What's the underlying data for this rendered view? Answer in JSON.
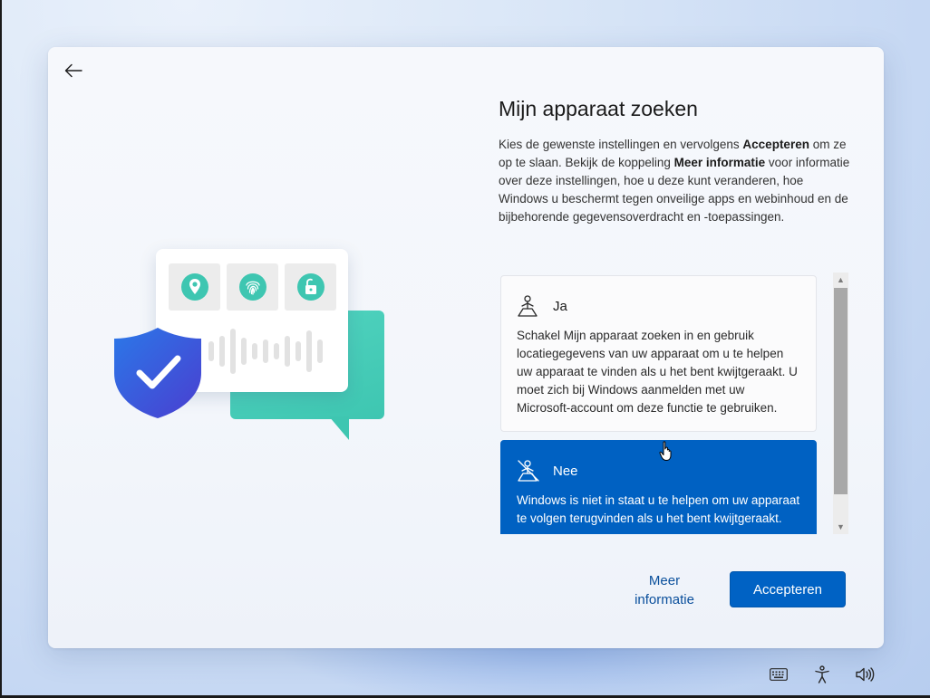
{
  "dialog": {
    "title": "Mijn apparaat zoeken",
    "description_parts": {
      "p1": "Kies de gewenste instellingen en vervolgens ",
      "b1": "Accepteren",
      "p2": " om ze op te slaan. Bekijk de koppeling ",
      "b2": "Meer informatie",
      "p3": " voor informatie over deze instellingen, hoe u deze kunt veranderen, hoe Windows u beschermt tegen onveilige apps en webinhoud en de bijbehorende gegevensoverdracht en -toepassingen."
    },
    "options": [
      {
        "label": "Ja",
        "icon": "location-person-icon",
        "text": "Schakel Mijn apparaat zoeken in en gebruik locatiegegevens van uw apparaat om u te helpen uw apparaat te vinden als u het bent kwijtgeraakt. U moet zich bij Windows aanmelden met uw Microsoft-account om deze functie te gebruiken.",
        "selected": false
      },
      {
        "label": "Nee",
        "icon": "location-person-off-icon",
        "text": "Windows is niet in staat u te helpen om uw apparaat te volgen terugvinden als u het bent kwijtgeraakt.",
        "selected": true
      }
    ],
    "more_info_line1": "Meer",
    "more_info_line2": "informatie",
    "accept_label": "Accepteren"
  },
  "tray": {
    "icons": [
      "keyboard-icon",
      "accessibility-icon",
      "volume-icon"
    ]
  },
  "colors": {
    "accent": "#0061c2",
    "teal": "#3ec6b1",
    "shield": "#2f5fd6",
    "link": "#0a4f9c"
  }
}
